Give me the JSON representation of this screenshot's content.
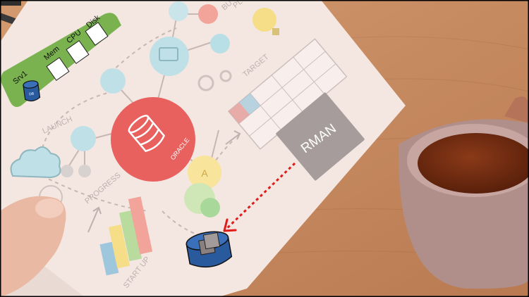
{
  "server_panel": {
    "server_label": "Srv1",
    "db_label": "DB",
    "metrics": [
      "Mem",
      "CPU",
      "Disk"
    ]
  },
  "sketch": {
    "launch_label": "LAUNCH",
    "progress_label": "PROGRESS",
    "startup_label": "START UP",
    "target_label": "TARGET",
    "oracle_label": "ORACLE",
    "a_label": "A",
    "bu_label": "BU",
    "pl_label": "PL"
  },
  "rman": {
    "label": "RMAN"
  },
  "colors": {
    "desk": "#c98a5e",
    "paper": "#f3e6e1",
    "oracle_red": "#e8615f",
    "panel_green": "#79b24f",
    "db_blue": "#2a5a9e",
    "arrow_red": "#e11a1a",
    "rman_gray": "#a79c9c",
    "cup": "#b08e8a",
    "coffee": "#7a2f12"
  }
}
